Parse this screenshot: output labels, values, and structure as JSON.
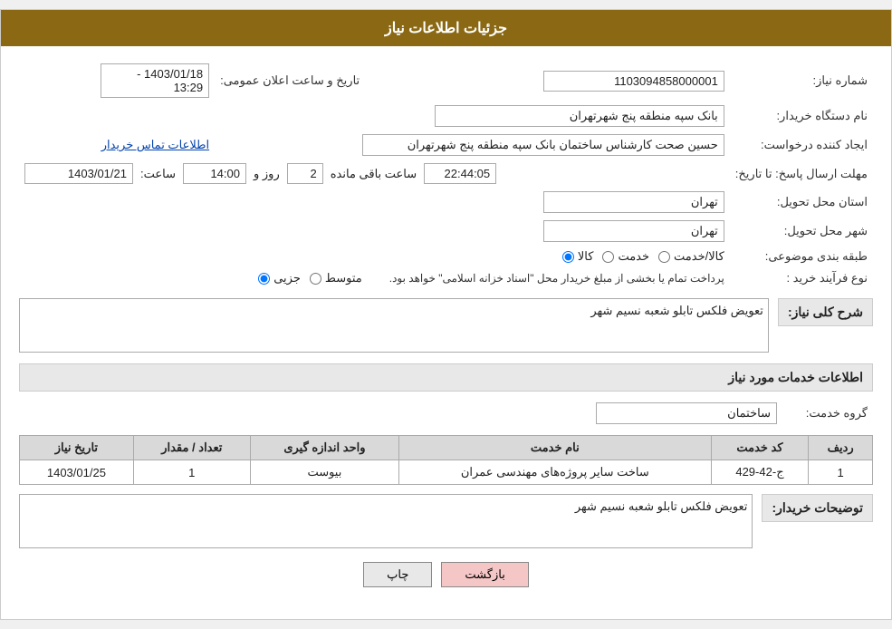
{
  "header": {
    "title": "جزئیات اطلاعات نیاز"
  },
  "fields": {
    "need_number_label": "شماره نیاز:",
    "need_number_value": "1103094858000001",
    "purchase_station_label": "نام دستگاه خریدار:",
    "purchase_station_value": "بانک سپه منطقه پنج شهرتهران",
    "date_label": "تاریخ و ساعت اعلان عمومی:",
    "date_value": "1403/01/18 - 13:29",
    "creator_label": "ایجاد کننده درخواست:",
    "creator_value": "حسین صحت کارشناس ساختمان بانک سپه منطقه پنج شهرتهران",
    "contact_link": "اطلاعات تماس خریدار",
    "response_deadline_label": "مهلت ارسال پاسخ: تا تاریخ:",
    "response_date": "1403/01/21",
    "response_time_label": "ساعت:",
    "response_time": "14:00",
    "response_days_label": "روز و",
    "response_days": "2",
    "response_remaining_label": "ساعت باقی مانده",
    "response_remaining": "22:44:05",
    "province_label": "استان محل تحویل:",
    "province_value": "تهران",
    "city_label": "شهر محل تحویل:",
    "city_value": "تهران",
    "category_label": "طبقه بندی موضوعی:",
    "radio_goods": "کالا",
    "radio_service": "خدمت",
    "radio_goods_service": "کالا/خدمت",
    "purchase_type_label": "نوع فرآیند خرید :",
    "radio_partial": "جزیی",
    "radio_medium": "متوسط",
    "notice_text": "پرداخت تمام یا بخشی از مبلغ خریدار محل \"اسناد خزانه اسلامی\" خواهد بود.",
    "description_label": "شرح کلی نیاز:",
    "description_value": "تعویض فلکس تابلو شعبه نسیم شهر"
  },
  "services_section": {
    "title": "اطلاعات خدمات مورد نیاز",
    "service_group_label": "گروه خدمت:",
    "service_group_value": "ساختمان",
    "table": {
      "columns": [
        "ردیف",
        "کد خدمت",
        "نام خدمت",
        "واحد اندازه گیری",
        "تعداد / مقدار",
        "تاریخ نیاز"
      ],
      "rows": [
        {
          "row_num": "1",
          "code": "ج-42-429",
          "name": "ساخت سایر پروژه‌های مهندسی عمران",
          "unit": "بیوست",
          "quantity": "1",
          "date": "1403/01/25"
        }
      ]
    },
    "buyer_desc_label": "توضیحات خریدار:",
    "buyer_desc_value": "تعویض فلکس تابلو شعبه نسیم شهر"
  },
  "buttons": {
    "print": "چاپ",
    "back": "بازگشت"
  }
}
